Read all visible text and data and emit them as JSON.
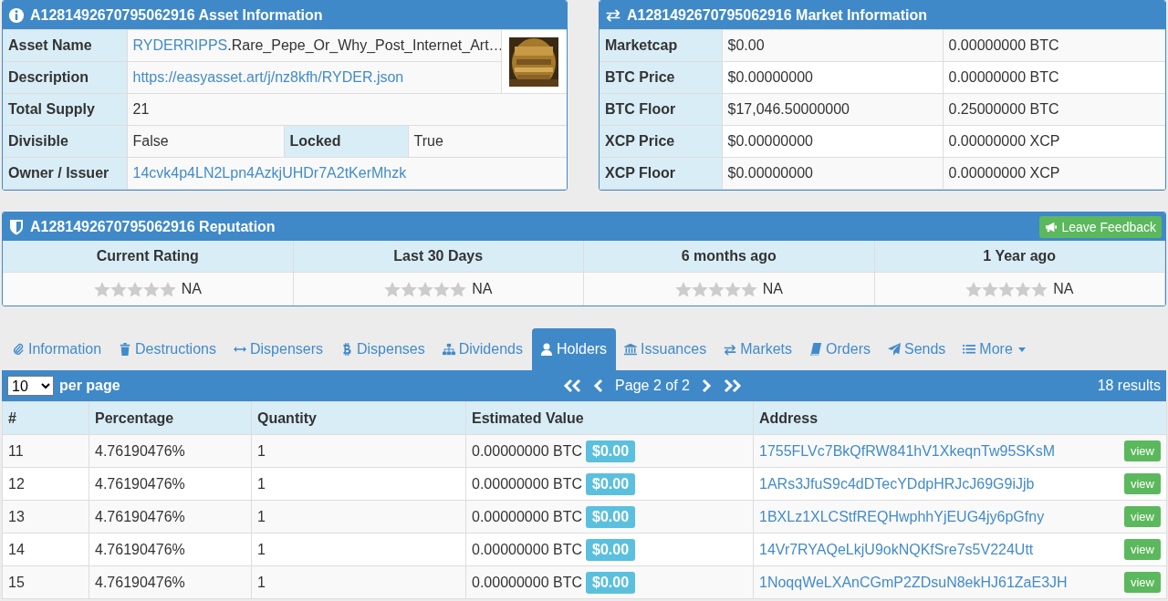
{
  "asset_info": {
    "title": "A1281492670795062916 Asset Information",
    "asset_name_label": "Asset Name",
    "asset_name_link": "RYDERRIPPS",
    "asset_name_rest": ".Rare_Pepe_Or_Why_Post_Internet_Art…",
    "description_label": "Description",
    "description": "https://easyasset.art/j/nz8kfh/RYDER.json",
    "total_supply_label": "Total Supply",
    "total_supply": "21",
    "divisible_label": "Divisible",
    "divisible": "False",
    "locked_label": "Locked",
    "locked": "True",
    "owner_label": "Owner / Issuer",
    "owner": "14cvk4p4LN2Lpn4AzkjUHDr7A2tKerMhzk"
  },
  "market_info": {
    "title": "A1281492670795062916 Market Information",
    "rows": [
      {
        "label": "Marketcap",
        "usd": "$0.00",
        "crypto": "0.00000000 BTC"
      },
      {
        "label": "BTC Price",
        "usd": "$0.00000000",
        "crypto": "0.00000000 BTC"
      },
      {
        "label": "BTC Floor",
        "usd": "$17,046.50000000",
        "crypto": "0.25000000 BTC"
      },
      {
        "label": "XCP Price",
        "usd": "$0.00000000",
        "crypto": "0.00000000 XCP"
      },
      {
        "label": "XCP Floor",
        "usd": "$0.00000000",
        "crypto": "0.00000000 XCP"
      }
    ]
  },
  "reputation": {
    "title": "A1281492670795062916 Reputation",
    "feedback_button": "Leave Feedback",
    "columns": [
      {
        "heading": "Current Rating",
        "stars": 0,
        "rating": "NA"
      },
      {
        "heading": "Last 30 Days",
        "stars": 0,
        "rating": "NA"
      },
      {
        "heading": "6 months ago",
        "stars": 0,
        "rating": "NA"
      },
      {
        "heading": "1 Year ago",
        "stars": 0,
        "rating": "NA"
      }
    ]
  },
  "tabs": [
    {
      "label": "Information",
      "selected": false
    },
    {
      "label": "Destructions",
      "selected": false
    },
    {
      "label": "Dispensers",
      "selected": false
    },
    {
      "label": "Dispenses",
      "selected": false
    },
    {
      "label": "Dividends",
      "selected": false
    },
    {
      "label": "Holders",
      "selected": true
    },
    {
      "label": "Issuances",
      "selected": false
    },
    {
      "label": "Markets",
      "selected": false
    },
    {
      "label": "Orders",
      "selected": false
    },
    {
      "label": "Sends",
      "selected": false
    },
    {
      "label": "More",
      "selected": false
    }
  ],
  "holders": {
    "per_page": "10",
    "per_page_label": "per page",
    "page_label": "Page 2 of 2",
    "results": "18 results",
    "columns": [
      "#",
      "Percentage",
      "Quantity",
      "Estimated Value",
      "Address"
    ],
    "rows": [
      {
        "rank": "11",
        "percentage": "4.76190476%",
        "quantity": "1",
        "btc": "0.00000000 BTC",
        "usd": "$0.00",
        "address": "1755FLVc7BkQfRW841hV1XkeqnTw95SKsM",
        "action": "view"
      },
      {
        "rank": "12",
        "percentage": "4.76190476%",
        "quantity": "1",
        "btc": "0.00000000 BTC",
        "usd": "$0.00",
        "address": "1ARs3JfuS9c4dDTecYDdpHRJcJ69G9iJjb",
        "action": "view"
      },
      {
        "rank": "13",
        "percentage": "4.76190476%",
        "quantity": "1",
        "btc": "0.00000000 BTC",
        "usd": "$0.00",
        "address": "1BXLz1XLCStfREQHwphhYjEUG4jy6pGfny",
        "action": "view"
      },
      {
        "rank": "14",
        "percentage": "4.76190476%",
        "quantity": "1",
        "btc": "0.00000000 BTC",
        "usd": "$0.00",
        "address": "14Vr7RYAQeLkjU9okNQKfSre7s5V224Utt",
        "action": "view"
      },
      {
        "rank": "15",
        "percentage": "4.76190476%",
        "quantity": "1",
        "btc": "0.00000000 BTC",
        "usd": "$0.00",
        "address": "1NoqqWeLXAnCGmP2ZDsuN8ekHJ61ZaE3JH",
        "action": "view"
      }
    ]
  }
}
